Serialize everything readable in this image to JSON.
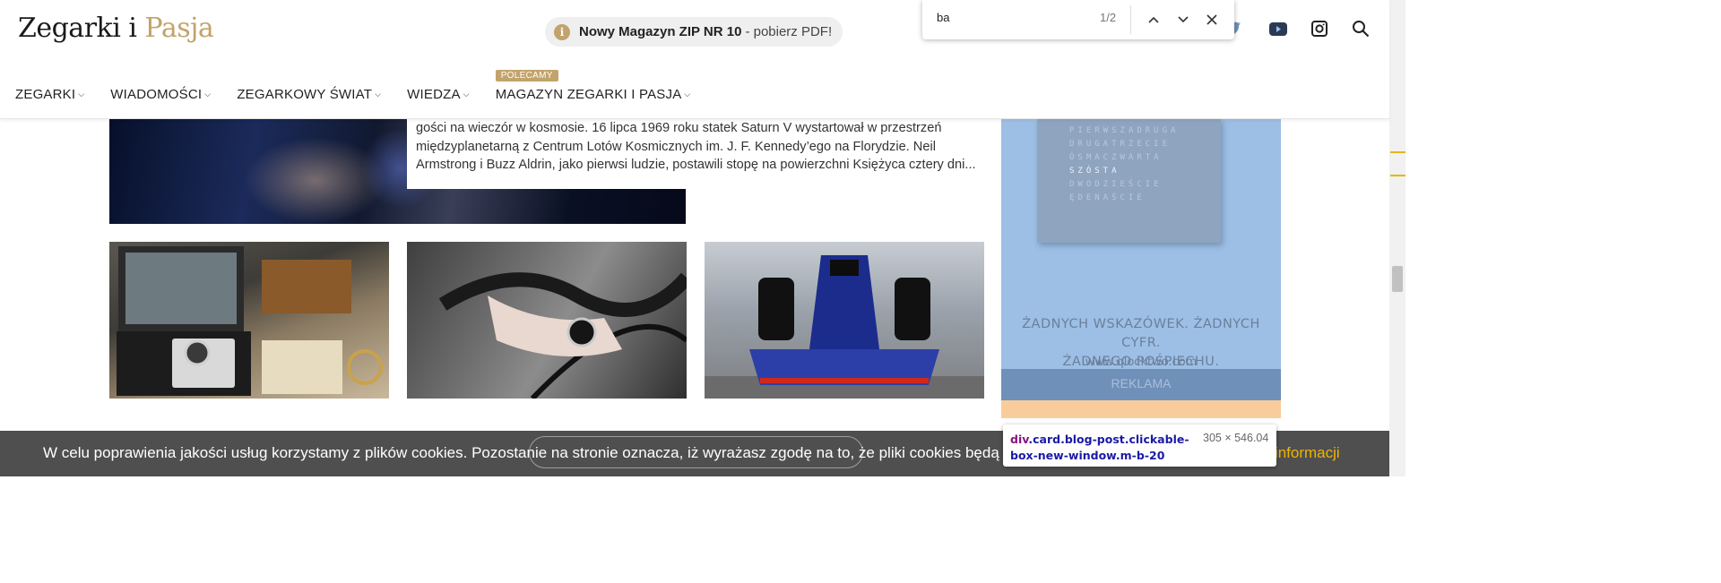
{
  "header": {
    "logo_part1": "Zegarki i",
    "logo_part2": "Pasja",
    "promo": {
      "icon": "info-icon",
      "info_glyph": "i",
      "bold": "Nowy Magazyn ZIP NR 10",
      "rest": "- pobierz PDF!"
    },
    "nav": [
      {
        "label": "ZEGARKI"
      },
      {
        "label": "WIADOMOŚCI"
      },
      {
        "label": "ZEGARKOWY ŚWIAT"
      },
      {
        "label": "WIEDZA"
      },
      {
        "label": "MAGAZYN ZEGARKI I PASJA",
        "badge": "POLECAMY"
      }
    ],
    "icons": [
      "twitter-icon",
      "youtube-icon",
      "instagram-icon",
      "search-icon"
    ]
  },
  "feature": {
    "excerpt_lines": [
      "gości na wieczór w kosmosie. 16 lipca 1969 roku statek Saturn V wystartował w przestrzeń",
      "międzyplanetarną z Centrum Lotów Kosmicznych im. J. F. Kennedy’ego na Florydzie. Neil",
      "Armstrong i Buzz Aldrin, jako pierwsi ludzie, postawili stopę na powierzchni Księżyca cztery dni..."
    ]
  },
  "ad": {
    "clock_rows": [
      "PIERWSZADRUGA",
      "DRUGATRZECIE",
      "ÓSMACZWARTA",
      "SZÓSTA",
      "DWODZIEŚCIE",
      "ĘDENAŚCIE"
    ],
    "clock_highlight": "SZÓSTA",
    "tagline_lines": [
      "ŻADNYCH WSKAZÓWEK. ŻADNYCH CYFR.",
      "ŻADNEGO POŚPIECHU."
    ],
    "url": "www.qlocktwo.com",
    "reklama": "REKLAMA"
  },
  "cookie": {
    "text": "W celu poprawienia jakości usług korzystamy z plików cookies. Pozostanie na stronie oznacza, iż wyrażasz zgodę na to, że pliki cookies będą przechowywane",
    "more": "ej informacji"
  },
  "devtools": {
    "tag": "div",
    "selector": ".card.blog-post.clickable-box-new-window.m-b-20",
    "dims": "305 × 546.04"
  },
  "findbar": {
    "query": "ba",
    "count": "1/2"
  },
  "colors": {
    "accent_gold": "#c2a36b",
    "devtools_content": "#9dbfe5",
    "devtools_margin": "#f9cc9c",
    "find_match": "#e5b700"
  }
}
